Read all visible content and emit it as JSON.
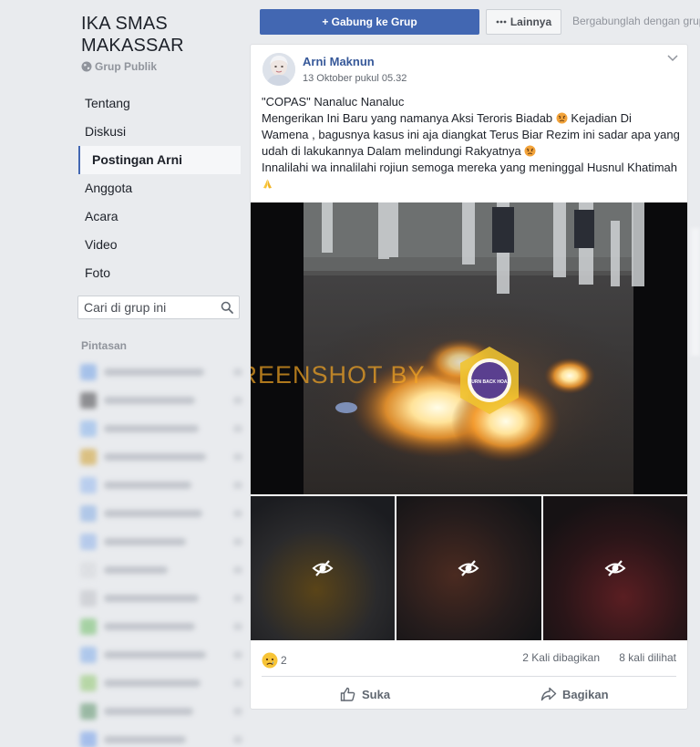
{
  "group": {
    "name": "IKA SMAS MAKASSAR",
    "privacy": "Grup Publik"
  },
  "nav": {
    "items": [
      {
        "label": "Tentang",
        "active": false
      },
      {
        "label": "Diskusi",
        "active": false
      },
      {
        "label": "Postingan Arni",
        "active": true
      },
      {
        "label": "Anggota",
        "active": false
      },
      {
        "label": "Acara",
        "active": false
      },
      {
        "label": "Video",
        "active": false
      },
      {
        "label": "Foto",
        "active": false
      }
    ]
  },
  "search": {
    "placeholder": "Cari di grup ini"
  },
  "shortcuts": {
    "title": "Pintasan"
  },
  "topbar": {
    "join_label": "+ Gabung ke Grup",
    "more_label": "Lainnya",
    "invite_text": "Bergabunglah dengan grup"
  },
  "post": {
    "author": "Arni Maknun",
    "timestamp": "13 Oktober pukul 05.32",
    "line1": "\"COPAS\" Nanaluc Nanaluc",
    "line2a": "Mengerikan Ini Baru yang namanya Aksi Teroris Biadab",
    "line2b": "Kejadian Di Wamena , bagusnya kasus ini aja diangkat Terus Biar Rezim ini sadar apa yang udah di lakukannya Dalam melindungi Rakyatnya",
    "line3": "Innalilahi wa innalilahi rojiun semoga mereka yang meninggal Husnul Khatimah",
    "watermark": "SCREENSHOT BY",
    "badge_top": "TURN BACK HOAX",
    "badge_bottom": "MAFINDO",
    "reaction_count": "2",
    "shares": "2 Kali dibagikan",
    "views": "8 kali dilihat",
    "like_label": "Suka",
    "share_label": "Bagikan"
  },
  "colors": {
    "brand_blue": "#4267b2",
    "link_blue": "#365899",
    "page_bg": "#e9ebee",
    "watermark": "#f5a623"
  }
}
